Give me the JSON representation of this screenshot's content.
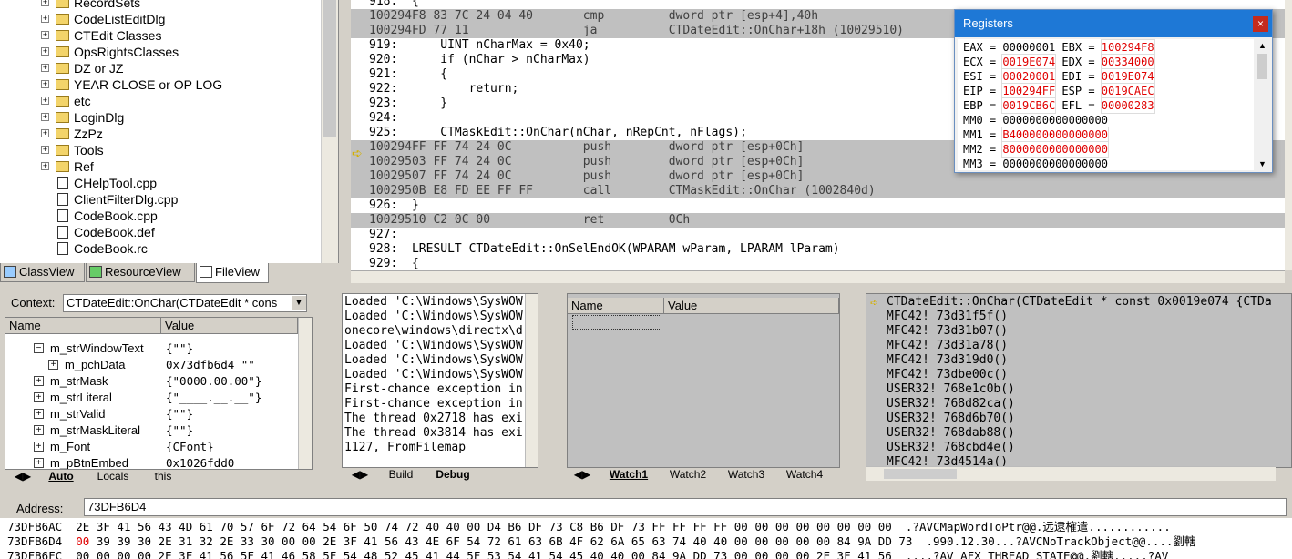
{
  "workspace": {
    "tree_items": [
      {
        "label": "RecordSets",
        "kind": "folder"
      },
      {
        "label": "CodeListEditDlg",
        "kind": "folder"
      },
      {
        "label": "CTEdit Classes",
        "kind": "folder"
      },
      {
        "label": "OpsRightsClasses",
        "kind": "folder"
      },
      {
        "label": "DZ or JZ",
        "kind": "folder"
      },
      {
        "label": "YEAR CLOSE or OP LOG",
        "kind": "folder"
      },
      {
        "label": "etc",
        "kind": "folder"
      },
      {
        "label": "LoginDlg",
        "kind": "folder"
      },
      {
        "label": "ZzPz",
        "kind": "folder"
      },
      {
        "label": "Tools",
        "kind": "folder"
      },
      {
        "label": "Ref",
        "kind": "folder"
      },
      {
        "label": "CHelpTool.cpp",
        "kind": "file"
      },
      {
        "label": "ClientFilterDlg.cpp",
        "kind": "file"
      },
      {
        "label": "CodeBook.cpp",
        "kind": "file"
      },
      {
        "label": "CodeBook.def",
        "kind": "file"
      },
      {
        "label": "CodeBook.rc",
        "kind": "file"
      }
    ],
    "tabs": [
      "ClassView",
      "ResourceView",
      "FileView"
    ],
    "active_tab": "FileView"
  },
  "code_lines": [
    {
      "text": "918:  {",
      "kind": "src"
    },
    {
      "text": "100294F8 83 7C 24 04 40       cmp         dword ptr [esp+4],40h",
      "kind": "asm"
    },
    {
      "text": "100294FD 77 11                ja          CTDateEdit::OnChar+18h (10029510)",
      "kind": "asm"
    },
    {
      "text": "919:      UINT nCharMax = 0x40;",
      "kind": "src"
    },
    {
      "text": "920:      if (nChar > nCharMax)",
      "kind": "src"
    },
    {
      "text": "921:      {",
      "kind": "src"
    },
    {
      "text": "922:          return;",
      "kind": "src"
    },
    {
      "text": "923:      }",
      "kind": "src"
    },
    {
      "text": "924:",
      "kind": "src"
    },
    {
      "text": "925:      CTMaskEdit::OnChar(nChar, nRepCnt, nFlags);",
      "kind": "src"
    },
    {
      "text": "100294FF FF 74 24 0C          push        dword ptr [esp+0Ch]",
      "kind": "asm"
    },
    {
      "text": "10029503 FF 74 24 0C          push        dword ptr [esp+0Ch]",
      "kind": "asm"
    },
    {
      "text": "10029507 FF 74 24 0C          push        dword ptr [esp+0Ch]",
      "kind": "asm"
    },
    {
      "text": "1002950B E8 FD EE FF FF       call        CTMaskEdit::OnChar (1002840d)",
      "kind": "asm"
    },
    {
      "text": "926:  }",
      "kind": "src"
    },
    {
      "text": "10029510 C2 0C 00             ret         0Ch",
      "kind": "asm"
    },
    {
      "text": "927:",
      "kind": "src"
    },
    {
      "text": "928:  LRESULT CTDateEdit::OnSelEndOK(WPARAM wParam, LPARAM lParam)",
      "kind": "src"
    },
    {
      "text": "929:  {",
      "kind": "src"
    }
  ],
  "registers": {
    "title": "Registers",
    "close": "×",
    "rows": [
      [
        {
          "name": "EAX",
          "value": "00000001",
          "changed": false
        },
        {
          "name": "EBX",
          "value": "100294F8",
          "changed": true
        }
      ],
      [
        {
          "name": "ECX",
          "value": "0019E074",
          "changed": true
        },
        {
          "name": "EDX",
          "value": "00334000",
          "changed": true
        }
      ],
      [
        {
          "name": "ESI",
          "value": "00020001",
          "changed": true
        },
        {
          "name": "EDI",
          "value": "0019E074",
          "changed": true
        }
      ],
      [
        {
          "name": "EIP",
          "value": "100294FF",
          "changed": true
        },
        {
          "name": "ESP",
          "value": "0019CAEC",
          "changed": true
        }
      ],
      [
        {
          "name": "EBP",
          "value": "0019CB6C",
          "changed": true
        },
        {
          "name": "EFL",
          "value": "00000283",
          "changed": true
        }
      ],
      [
        {
          "name": "MM0",
          "value": "0000000000000000",
          "changed": false
        }
      ],
      [
        {
          "name": "MM1",
          "value": "B400000000000000",
          "changed": true
        }
      ],
      [
        {
          "name": "MM2",
          "value": "8000000000000000",
          "changed": true
        }
      ],
      [
        {
          "name": "MM3",
          "value": "0000000000000000",
          "changed": false
        }
      ]
    ]
  },
  "variables": {
    "context_label": "Context:",
    "context_value": "CTDateEdit::OnChar(CTDateEdit * cons",
    "col_name": "Name",
    "col_value": "Value",
    "rows": [
      {
        "name": "m_strWindowText",
        "value": "{\"\"}",
        "indent": 1,
        "expander": "−"
      },
      {
        "name": "m_pchData",
        "value": "0x73dfb6d4 \"\"",
        "indent": 2,
        "expander": "+"
      },
      {
        "name": "m_strMask",
        "value": "{\"0000.00.00\"}",
        "indent": 1,
        "expander": "+"
      },
      {
        "name": "m_strLiteral",
        "value": "{\"____.__.__\"}",
        "indent": 1,
        "expander": "+"
      },
      {
        "name": "m_strValid",
        "value": "{\"\"}",
        "indent": 1,
        "expander": "+"
      },
      {
        "name": "m_strMaskLiteral",
        "value": "{\"\"}",
        "indent": 1,
        "expander": "+"
      },
      {
        "name": "m_Font",
        "value": "{CFont}",
        "indent": 1,
        "expander": "+"
      },
      {
        "name": "m_pBtnEmbed",
        "value": "0x1026fdd0",
        "indent": 1,
        "expander": "+"
      }
    ],
    "tabs": [
      "Auto",
      "Locals",
      "this"
    ],
    "active_tab": "Auto"
  },
  "output": {
    "lines": [
      "Loaded 'C:\\Windows\\SysWOW",
      "Loaded 'C:\\Windows\\SysWOW",
      "onecore\\windows\\directx\\d",
      "Loaded 'C:\\Windows\\SysWOW",
      "Loaded 'C:\\Windows\\SysWOW",
      "Loaded 'C:\\Windows\\SysWOW",
      "First-chance exception in",
      "First-chance exception in",
      "The thread 0x2718 has exi",
      "The thread 0x3814 has exi",
      "1127, FromFilemap"
    ],
    "tabs": [
      "Build",
      "Debug"
    ],
    "active_tab": "Debug"
  },
  "watch": {
    "col_name": "Name",
    "col_value": "Value",
    "tabs": [
      "Watch1",
      "Watch2",
      "Watch3",
      "Watch4"
    ],
    "active_tab": "Watch1"
  },
  "callstack": {
    "rows": [
      "CTDateEdit::OnChar(CTDateEdit * const 0x0019e074 {CTDa",
      "MFC42! 73d31f5f()",
      "MFC42! 73d31b07()",
      "MFC42! 73d31a78()",
      "MFC42! 73d319d0()",
      "MFC42! 73dbe00c()",
      "USER32! 768e1c0b()",
      "USER32! 768d82ca()",
      "USER32! 768d6b70()",
      "USER32! 768dab88()",
      "USER32! 768cbd4e()",
      "MFC42! 73d4514a()"
    ]
  },
  "memory": {
    "address_label": "Address:",
    "address_value": "73DFB6D4",
    "lines": [
      {
        "addr": "73DFB6AC",
        "bytes": "2E 3F 41 56 43 4D 61 70 57 6F 72 64 54 6F 50 74 72 40 40 00 D4 B6 DF 73 C8 B6 DF 73 FF FF FF FF 00 00 00 00 00 00 00 00",
        "ascii": ".?AVCMapWordToPtr@@.远逮榷遣............"
      },
      {
        "addr": "73DFB6D4",
        "first": "00",
        "bytes": " 39 39 30 2E 31 32 2E 33 30 00 00 2E 3F 41 56 43 4E 6F 54 72 61 63 6B 4F 62 6A 65 63 74 40 40 00 00 00 00 00 84 9A DD 73",
        "ascii": ".990.12.30...?AVCNoTrackObject@@....劉轄"
      },
      {
        "addr": "73DFB6FC",
        "bytes": "00 00 00 00 2E 3F 41 56 5F 41 46 58 5F 54 48 52 45 41 44 5F 53 54 41 54 45 40 40 00 84 9A DD 73 00 00 00 00 2E 3F 41 56",
        "ascii": "....?AV_AFX_THREAD_STATE@@.劉轄.....?AV"
      }
    ]
  }
}
